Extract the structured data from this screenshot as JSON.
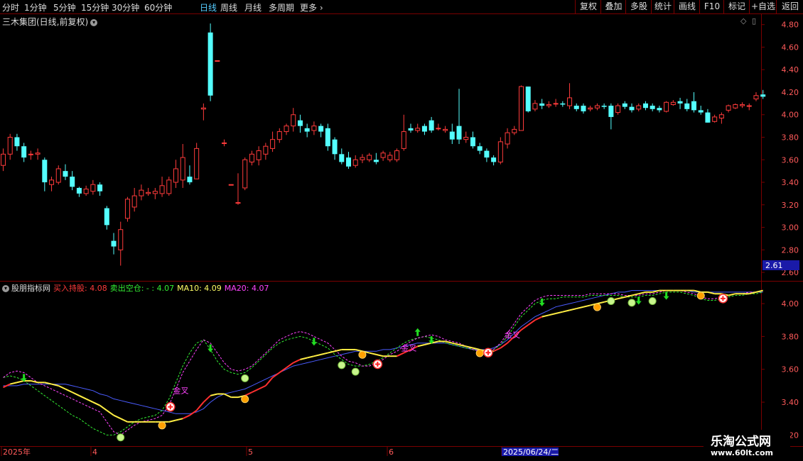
{
  "toolbar": {
    "periods": [
      "分时",
      "1分钟",
      "5分钟",
      "15分钟",
      "30分钟",
      "60分钟",
      "日线",
      "周线",
      "月线",
      "多周期",
      "更多"
    ],
    "active_period": "日线",
    "right_buttons": [
      "复权",
      "叠加",
      "多股",
      "统计",
      "画线",
      "F10",
      "标记",
      "+自选",
      "返回"
    ]
  },
  "stock_title": "三木集团(日线,前复权)",
  "indicator": {
    "name": "股朋指标网",
    "items": [
      {
        "label": "买入持股: 4.08",
        "color": "#ff3b3b"
      },
      {
        "label": "卖出空仓: - : 4.07",
        "color": "#33ee33"
      },
      {
        "label": "MA10: 4.09",
        "color": "#ffff66"
      },
      {
        "label": "MA20: 4.07",
        "color": "#ff44ff"
      }
    ]
  },
  "price_marker": "2.61",
  "xaxis": {
    "labels": [
      "2025年",
      "4",
      "5",
      "6",
      "2025/06/24/二"
    ]
  },
  "watermark": {
    "line1": "乐淘公式网",
    "line2": "www.60lt.com"
  },
  "colors": {
    "up": "#ff3b3b",
    "down": "#54ffff",
    "grid": "#7a0000",
    "axis_text": "#ff5a5a"
  },
  "chart_data": [
    {
      "type": "candlestick",
      "title": "三木集团(日线,前复权)",
      "yticks": [
        2.6,
        2.8,
        3.0,
        3.2,
        3.4,
        3.6,
        3.8,
        4.0,
        4.2,
        4.4,
        4.6,
        4.8
      ],
      "ylim": [
        2.55,
        4.88
      ],
      "candles": [
        [
          3.55,
          3.65,
          3.7,
          3.5
        ],
        [
          3.65,
          3.8,
          3.83,
          3.6
        ],
        [
          3.8,
          3.72,
          3.83,
          3.68
        ],
        [
          3.72,
          3.62,
          3.75,
          3.58
        ],
        [
          3.65,
          3.65,
          3.68,
          3.6
        ],
        [
          3.65,
          3.66,
          3.7,
          3.6
        ],
        [
          3.6,
          3.4,
          3.62,
          3.32
        ],
        [
          3.38,
          3.42,
          3.45,
          3.32
        ],
        [
          3.4,
          3.52,
          3.55,
          3.38
        ],
        [
          3.5,
          3.45,
          3.56,
          3.42
        ],
        [
          3.45,
          3.36,
          3.5,
          3.33
        ],
        [
          3.35,
          3.3,
          3.36,
          3.27
        ],
        [
          3.3,
          3.34,
          3.37,
          3.28
        ],
        [
          3.32,
          3.38,
          3.42,
          3.29
        ],
        [
          3.38,
          3.32,
          3.4,
          3.28
        ],
        [
          3.17,
          3.02,
          3.19,
          2.98
        ],
        [
          2.88,
          2.83,
          2.95,
          2.76
        ],
        [
          2.8,
          2.98,
          3.05,
          2.66
        ],
        [
          3.08,
          3.25,
          3.27,
          3.05
        ],
        [
          3.18,
          3.28,
          3.35,
          3.14
        ],
        [
          3.28,
          3.33,
          3.38,
          3.24
        ],
        [
          3.3,
          3.31,
          3.35,
          3.28
        ],
        [
          3.3,
          3.32,
          3.35,
          3.25
        ],
        [
          3.3,
          3.37,
          3.45,
          3.27
        ],
        [
          3.3,
          3.42,
          3.45,
          3.28
        ],
        [
          3.4,
          3.52,
          3.6,
          3.35
        ],
        [
          3.42,
          3.62,
          3.74,
          3.35
        ],
        [
          3.45,
          3.4,
          3.55,
          3.38
        ],
        [
          3.43,
          3.7,
          3.75,
          3.43
        ],
        [
          4.05,
          4.06,
          4.1,
          3.95
        ],
        [
          4.73,
          4.17,
          4.81,
          4.12
        ],
        [
          4.48,
          4.48,
          4.48,
          4.48
        ],
        [
          3.75,
          3.75,
          3.78,
          3.72
        ],
        [
          3.38,
          3.38,
          3.38,
          3.38
        ],
        [
          3.22,
          3.22,
          3.48,
          3.2
        ],
        [
          3.35,
          3.6,
          3.62,
          3.33
        ],
        [
          3.58,
          3.65,
          3.68,
          3.55
        ],
        [
          3.6,
          3.68,
          3.72,
          3.55
        ],
        [
          3.65,
          3.72,
          3.75,
          3.6
        ],
        [
          3.7,
          3.78,
          3.85,
          3.67
        ],
        [
          3.78,
          3.85,
          3.88,
          3.75
        ],
        [
          3.85,
          3.9,
          3.92,
          3.82
        ],
        [
          3.9,
          4.0,
          4.06,
          3.85
        ],
        [
          3.95,
          3.9,
          4.0,
          3.84
        ],
        [
          3.88,
          3.85,
          3.92,
          3.8
        ],
        [
          3.86,
          3.9,
          3.94,
          3.82
        ],
        [
          3.9,
          3.85,
          3.92,
          3.8
        ],
        [
          3.88,
          3.72,
          3.92,
          3.68
        ],
        [
          3.78,
          3.65,
          3.8,
          3.6
        ],
        [
          3.65,
          3.58,
          3.7,
          3.56
        ],
        [
          3.62,
          3.54,
          3.67,
          3.52
        ],
        [
          3.55,
          3.6,
          3.64,
          3.53
        ],
        [
          3.6,
          3.62,
          3.65,
          3.57
        ],
        [
          3.6,
          3.64,
          3.66,
          3.58
        ],
        [
          3.6,
          3.58,
          3.66,
          3.56
        ],
        [
          3.62,
          3.66,
          3.68,
          3.59
        ],
        [
          3.6,
          3.64,
          3.67,
          3.58
        ],
        [
          3.6,
          3.68,
          3.7,
          3.58
        ],
        [
          3.7,
          3.85,
          4.0,
          3.68
        ],
        [
          3.88,
          3.86,
          3.92,
          3.84
        ],
        [
          3.86,
          3.88,
          3.92,
          3.84
        ],
        [
          3.9,
          3.85,
          3.92,
          3.82
        ],
        [
          3.95,
          3.86,
          3.98,
          3.84
        ],
        [
          3.88,
          3.88,
          3.92,
          3.86
        ],
        [
          3.86,
          3.87,
          3.9,
          3.84
        ],
        [
          3.85,
          3.78,
          3.92,
          3.74
        ],
        [
          3.9,
          3.78,
          4.23,
          3.74
        ],
        [
          3.78,
          3.8,
          3.85,
          3.75
        ],
        [
          3.8,
          3.72,
          3.85,
          3.7
        ],
        [
          3.72,
          3.68,
          3.75,
          3.65
        ],
        [
          3.68,
          3.62,
          3.7,
          3.58
        ],
        [
          3.62,
          3.58,
          3.64,
          3.55
        ],
        [
          3.58,
          3.76,
          3.8,
          3.56
        ],
        [
          3.74,
          3.84,
          3.88,
          3.7
        ],
        [
          3.84,
          3.87,
          3.9,
          3.82
        ],
        [
          3.86,
          4.25,
          4.26,
          3.86
        ],
        [
          4.25,
          4.03,
          4.25,
          4.02
        ],
        [
          4.05,
          4.1,
          4.13,
          4.03
        ],
        [
          4.1,
          4.08,
          4.14,
          4.05
        ],
        [
          4.08,
          4.09,
          4.12,
          4.06
        ],
        [
          4.1,
          4.1,
          4.14,
          4.07
        ],
        [
          4.1,
          4.09,
          4.12,
          4.07
        ],
        [
          4.08,
          4.15,
          4.28,
          4.05
        ],
        [
          4.08,
          4.05,
          4.1,
          4.03
        ],
        [
          4.08,
          4.03,
          4.1,
          4.01
        ],
        [
          4.05,
          4.06,
          4.08,
          4.03
        ],
        [
          4.06,
          4.08,
          4.1,
          4.04
        ],
        [
          4.08,
          4.07,
          4.1,
          4.05
        ],
        [
          4.08,
          3.98,
          4.1,
          3.87
        ],
        [
          4.02,
          4.08,
          4.1,
          4.0
        ],
        [
          4.1,
          4.07,
          4.12,
          4.05
        ],
        [
          4.07,
          4.04,
          4.1,
          4.02
        ],
        [
          4.05,
          4.08,
          4.1,
          4.03
        ],
        [
          4.1,
          4.06,
          4.12,
          4.04
        ],
        [
          4.08,
          4.05,
          4.1,
          4.03
        ],
        [
          4.06,
          4.04,
          4.08,
          4.02
        ],
        [
          4.03,
          4.11,
          4.12,
          4.02
        ],
        [
          4.09,
          4.11,
          4.13,
          4.08
        ],
        [
          4.12,
          4.1,
          4.15,
          4.05
        ],
        [
          4.1,
          4.05,
          4.14,
          4.03
        ],
        [
          4.12,
          4.04,
          4.2,
          4.02
        ],
        [
          4.04,
          4.02,
          4.08,
          4.0
        ],
        [
          4.02,
          3.93,
          4.05,
          3.93
        ],
        [
          3.94,
          3.98,
          4.0,
          3.93
        ],
        [
          3.97,
          4.0,
          4.02,
          3.92
        ],
        [
          4.04,
          4.08,
          4.09,
          4.02
        ],
        [
          4.06,
          4.09,
          4.1,
          4.05
        ],
        [
          4.08,
          4.09,
          4.11,
          4.06
        ],
        [
          4.08,
          4.08,
          4.1,
          4.04
        ],
        [
          4.14,
          4.17,
          4.2,
          4.12
        ],
        [
          4.18,
          4.16,
          4.22,
          4.14
        ]
      ]
    },
    {
      "type": "line",
      "title": "股朋指标网",
      "yticks": [
        3.2,
        3.4,
        3.6,
        3.8,
        4.0
      ],
      "ylim": [
        3.18,
        4.13
      ],
      "series": [
        {
          "name": "MA10",
          "values": [
            3.49,
            3.51,
            3.52,
            3.53,
            3.53,
            3.52,
            3.52,
            3.51,
            3.5,
            3.48,
            3.46,
            3.44,
            3.42,
            3.4,
            3.38,
            3.35,
            3.32,
            3.3,
            3.28,
            3.28,
            3.28,
            3.28,
            3.28,
            3.28,
            3.28,
            3.29,
            3.3,
            3.32,
            3.35,
            3.4,
            3.44,
            3.45,
            3.45,
            3.43,
            3.43,
            3.44,
            3.46,
            3.48,
            3.5,
            3.55,
            3.58,
            3.61,
            3.64,
            3.66,
            3.67,
            3.68,
            3.69,
            3.7,
            3.71,
            3.72,
            3.72,
            3.72,
            3.71,
            3.7,
            3.69,
            3.68,
            3.68,
            3.68,
            3.7,
            3.72,
            3.74,
            3.75,
            3.76,
            3.77,
            3.77,
            3.76,
            3.75,
            3.74,
            3.73,
            3.72,
            3.71,
            3.71,
            3.73,
            3.76,
            3.8,
            3.84,
            3.87,
            3.9,
            3.92,
            3.93,
            3.94,
            3.95,
            3.96,
            3.97,
            3.98,
            3.99,
            4.0,
            4.01,
            4.02,
            4.03,
            4.04,
            4.05,
            4.06,
            4.07,
            4.07,
            4.08,
            4.08,
            4.08,
            4.08,
            4.08,
            4.08,
            4.07,
            4.07,
            4.06,
            4.06,
            4.05,
            4.06,
            4.06,
            4.06,
            4.07,
            4.08
          ]
        },
        {
          "name": "MA20",
          "values": [
            3.5,
            3.5,
            3.5,
            3.51,
            3.51,
            3.51,
            3.51,
            3.51,
            3.51,
            3.51,
            3.5,
            3.49,
            3.48,
            3.47,
            3.45,
            3.44,
            3.42,
            3.41,
            3.4,
            3.39,
            3.38,
            3.37,
            3.36,
            3.35,
            3.34,
            3.33,
            3.33,
            3.33,
            3.34,
            3.36,
            3.4,
            3.43,
            3.45,
            3.46,
            3.47,
            3.48,
            3.5,
            3.52,
            3.54,
            3.56,
            3.58,
            3.6,
            3.62,
            3.63,
            3.64,
            3.65,
            3.66,
            3.67,
            3.68,
            3.69,
            3.7,
            3.71,
            3.71,
            3.71,
            3.71,
            3.72,
            3.72,
            3.73,
            3.74,
            3.75,
            3.76,
            3.76,
            3.76,
            3.76,
            3.76,
            3.75,
            3.74,
            3.73,
            3.72,
            3.72,
            3.72,
            3.73,
            3.75,
            3.78,
            3.82,
            3.86,
            3.89,
            3.92,
            3.94,
            3.96,
            3.98,
            3.99,
            4.0,
            4.01,
            4.02,
            4.03,
            4.04,
            4.05,
            4.06,
            4.07,
            4.07,
            4.08,
            4.08,
            4.08,
            4.08,
            4.08,
            4.08,
            4.08,
            4.08,
            4.08,
            4.07,
            4.07,
            4.07,
            4.07,
            4.07,
            4.07,
            4.07,
            4.07,
            4.07,
            4.07,
            4.07
          ]
        },
        {
          "name": "买入持股",
          "values": [
            3.55,
            3.58,
            3.59,
            3.58,
            3.55,
            3.52,
            3.5,
            3.48,
            3.46,
            3.44,
            3.42,
            3.4,
            3.38,
            3.36,
            3.34,
            3.28,
            3.22,
            3.2,
            3.23,
            3.26,
            3.28,
            3.29,
            3.3,
            3.32,
            3.38,
            3.48,
            3.58,
            3.65,
            3.72,
            3.78,
            3.76,
            3.7,
            3.64,
            3.6,
            3.59,
            3.6,
            3.62,
            3.66,
            3.7,
            3.74,
            3.78,
            3.8,
            3.82,
            3.83,
            3.82,
            3.8,
            3.78,
            3.76,
            3.72,
            3.68,
            3.65,
            3.64,
            3.62,
            3.62,
            3.64,
            3.66,
            3.69,
            3.71,
            3.74,
            3.77,
            3.79,
            3.8,
            3.81,
            3.8,
            3.78,
            3.77,
            3.76,
            3.74,
            3.72,
            3.71,
            3.71,
            3.72,
            3.76,
            3.82,
            3.88,
            3.94,
            3.98,
            4.02,
            4.04,
            4.05,
            4.05,
            4.05,
            4.05,
            4.05,
            4.05,
            4.06,
            4.06,
            4.06,
            4.06,
            4.06,
            4.05,
            4.05,
            4.05,
            4.06,
            4.06,
            4.07,
            4.08,
            4.08,
            4.08,
            4.07,
            4.06,
            4.04,
            4.03,
            4.03,
            4.04,
            4.05,
            4.06,
            4.06,
            4.07,
            4.07,
            4.08
          ]
        },
        {
          "name": "卖出空仓",
          "values": [
            3.55,
            3.56,
            3.55,
            3.53,
            3.5,
            3.47,
            3.44,
            3.41,
            3.38,
            3.35,
            3.32,
            3.3,
            3.27,
            3.24,
            3.22,
            3.2,
            3.2,
            3.22,
            3.25,
            3.28,
            3.3,
            3.31,
            3.32,
            3.35,
            3.42,
            3.52,
            3.62,
            3.7,
            3.76,
            3.78,
            3.72,
            3.65,
            3.6,
            3.58,
            3.57,
            3.58,
            3.61,
            3.65,
            3.69,
            3.73,
            3.76,
            3.78,
            3.79,
            3.8,
            3.79,
            3.77,
            3.75,
            3.73,
            3.69,
            3.66,
            3.63,
            3.62,
            3.62,
            3.63,
            3.65,
            3.67,
            3.7,
            3.73,
            3.76,
            3.78,
            3.79,
            3.8,
            3.79,
            3.78,
            3.76,
            3.75,
            3.74,
            3.73,
            3.72,
            3.71,
            3.71,
            3.72,
            3.75,
            3.8,
            3.86,
            3.92,
            3.96,
            4.0,
            4.02,
            4.03,
            4.03,
            4.04,
            4.04,
            4.04,
            4.04,
            4.05,
            4.05,
            4.05,
            4.05,
            4.05,
            4.04,
            4.04,
            4.04,
            4.05,
            4.05,
            4.06,
            4.07,
            4.07,
            4.07,
            4.06,
            4.05,
            4.03,
            4.02,
            4.02,
            4.03,
            4.04,
            4.05,
            4.05,
            4.06,
            4.06,
            4.07
          ]
        }
      ],
      "signals": {
        "buy_arrow_down": [
          3,
          30,
          45,
          62,
          78,
          92,
          96
        ],
        "sell_arrow": [
          60
        ],
        "apple": [
          17,
          35,
          49,
          51,
          88,
          91,
          94
        ],
        "orange": [
          23,
          35,
          52,
          69,
          86,
          101
        ],
        "plus": [
          24,
          54,
          70,
          104
        ],
        "cross_label": [
          {
            "index": 25,
            "text": "金叉"
          },
          {
            "index": 58,
            "text": "金叉"
          },
          {
            "index": 73,
            "text": "金叉"
          }
        ]
      }
    }
  ]
}
